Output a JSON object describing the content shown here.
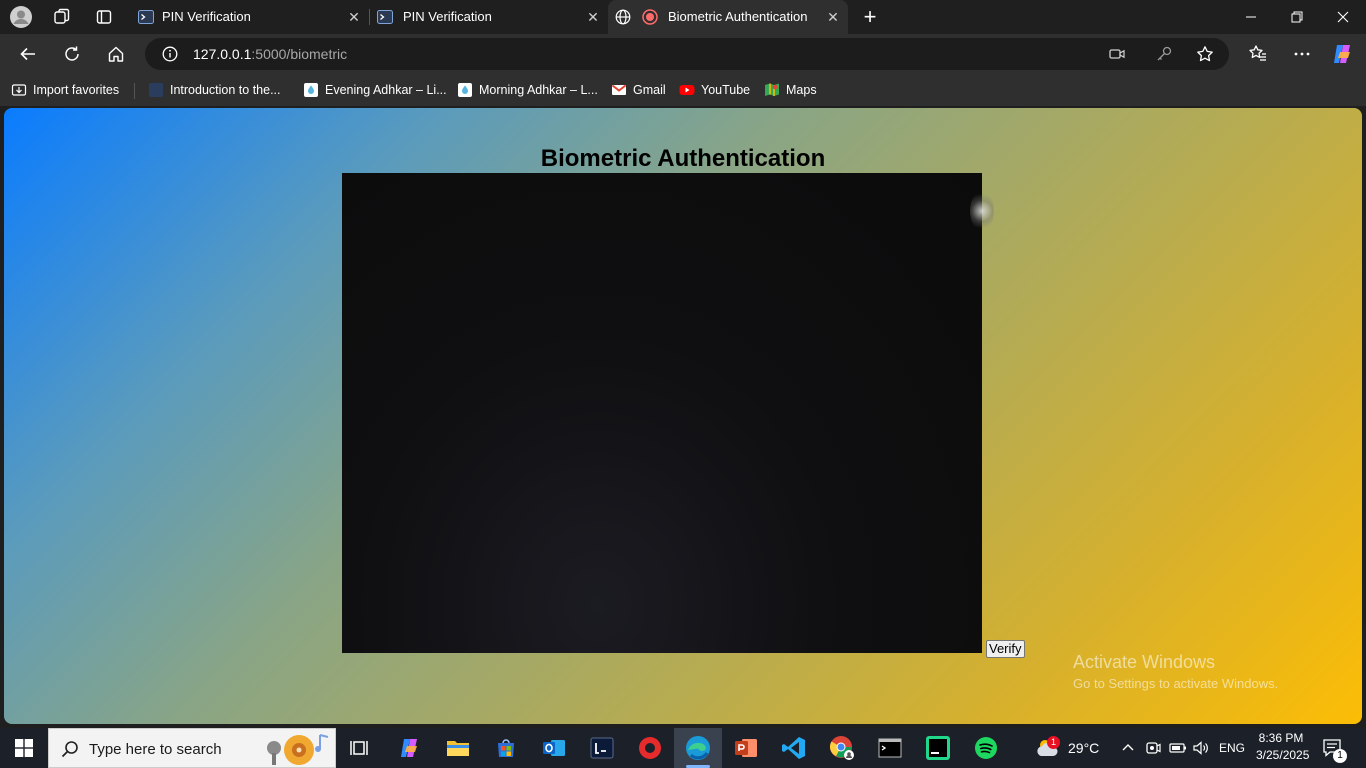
{
  "browser": {
    "tabs": [
      {
        "label": "PIN Verification",
        "active": false
      },
      {
        "label": "PIN Verification",
        "active": false
      },
      {
        "label": "Biometric Authentication",
        "active": true
      }
    ],
    "close_glyph": "✕",
    "new_tab_glyph": "+",
    "address": {
      "host": "127.0.0.1",
      "path": ":5000/biometric"
    }
  },
  "bookmarks": [
    {
      "label": "Import favorites",
      "icon": "import-icon"
    },
    {
      "label": "Introduction to the...",
      "icon": "page-icon"
    },
    {
      "label": "Evening Adhkar – Li...",
      "icon": "drop-icon"
    },
    {
      "label": "Morning Adhkar – L...",
      "icon": "drop-icon"
    },
    {
      "label": "Gmail",
      "icon": "gmail-icon"
    },
    {
      "label": "YouTube",
      "icon": "youtube-icon"
    },
    {
      "label": "Maps",
      "icon": "maps-icon"
    }
  ],
  "page": {
    "title": "Biometric Authentication",
    "verify_label": "Verify"
  },
  "watermark": {
    "title": "Activate Windows",
    "subtitle": "Go to Settings to activate Windows."
  },
  "taskbar": {
    "search_placeholder": "Type here to search",
    "weather": "29°C",
    "language": "ENG",
    "time": "8:36 PM",
    "date": "3/25/2025",
    "weather_badge": "1",
    "notification_count": "1"
  },
  "colors": {
    "gradient_start": "#0a7cff",
    "gradient_end": "#fcbd05",
    "browser_chrome": "#2f2f2f",
    "taskbar": "#1c2129"
  }
}
